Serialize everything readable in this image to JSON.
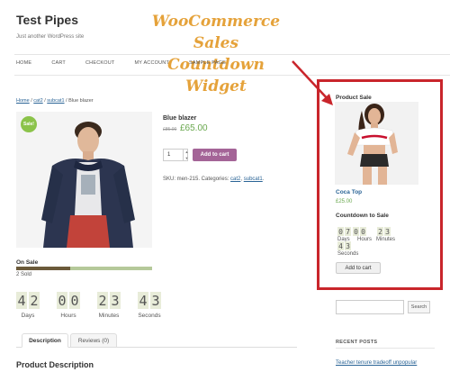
{
  "site": {
    "title": "Test Pipes",
    "tagline": "Just another WordPress site"
  },
  "annotation": {
    "line1": "WooCommerce Sales",
    "line2": "Countdown Widget",
    "color": "#e5a23a",
    "arrow_color": "#c9252b"
  },
  "nav": [
    "HOME",
    "CART",
    "CHECKOUT",
    "MY ACCOUNT",
    "SAMPLE PAGE"
  ],
  "breadcrumb": {
    "home": "Home",
    "cat": "cat2",
    "subcat": "subcat1",
    "sep": " / ",
    "current": "Blue blazer"
  },
  "product": {
    "badge": "Sale!",
    "title": "Blue blazer",
    "price_old": "£85.00",
    "price_new": "£65.00",
    "qty": "1",
    "add_to_cart": "Add to cart",
    "sku_prefix": "SKU: men-215. Categories: ",
    "cat1": "cat2",
    "cat_sep": ", ",
    "cat2": "subcat1",
    "sku_suffix": ".",
    "image_icon": "product-photo-man-blazer"
  },
  "sale": {
    "label": "On Sale",
    "sold": "2 Sold",
    "progress_fraction": 0.4
  },
  "countdown": [
    {
      "digits": [
        "4",
        "2"
      ],
      "label": "Days"
    },
    {
      "digits": [
        "0",
        "0"
      ],
      "label": "Hours"
    },
    {
      "digits": [
        "2",
        "3"
      ],
      "label": "Minutes"
    },
    {
      "digits": [
        "4",
        "3"
      ],
      "label": "Seconds"
    }
  ],
  "tabs": {
    "description": "Description",
    "reviews": "Reviews (0)"
  },
  "description_heading": "Product Description",
  "widget": {
    "title": "Product Sale",
    "product_name": "Coca Top",
    "price": "£25.00",
    "countdown_title": "Countdown to Sale",
    "days_digits": [
      "0",
      "7"
    ],
    "hours_digits": [
      "0",
      "0"
    ],
    "minutes_digits": [
      "2",
      "3"
    ],
    "seconds_digits": [
      "4",
      "3"
    ],
    "days_label": "Days",
    "hours_label": "Hours",
    "minutes_label": "Minutes",
    "seconds_label": "Seconds",
    "button": "Add to cart",
    "image_icon": "product-photo-woman-crop-top"
  },
  "sidebar": {
    "search_button": "Search",
    "recent_posts_title": "RECENT POSTS",
    "recent_post_1": "Teacher tenure tradeoff unpopular"
  },
  "colors": {
    "accent_purple": "#a46497",
    "price_green": "#6aa84f",
    "highlight_red": "#c9252b",
    "link_blue": "#2a6496"
  }
}
